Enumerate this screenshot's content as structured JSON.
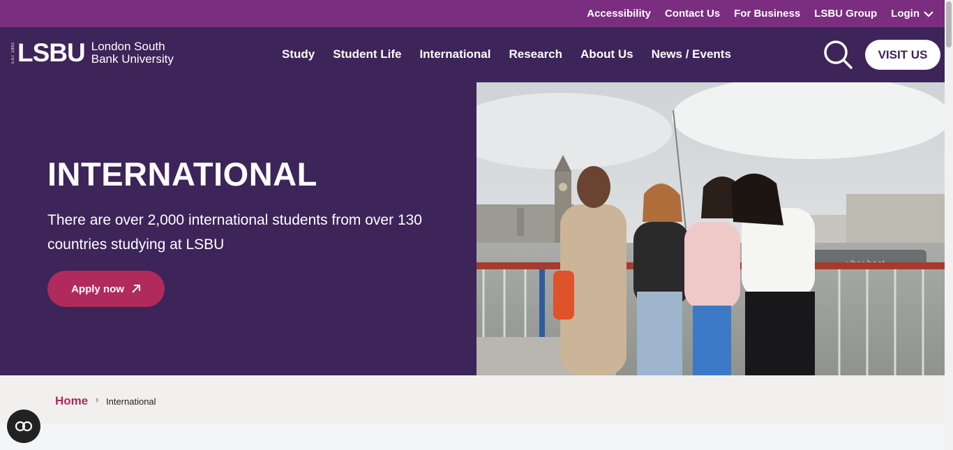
{
  "topbar": {
    "links": [
      "Accessibility",
      "Contact Us",
      "For Business",
      "LSBU Group"
    ],
    "login_label": "Login"
  },
  "logo": {
    "est": "EST 1892",
    "mark": "LSBU",
    "full_line1": "London South",
    "full_line2": "Bank University"
  },
  "nav": {
    "items": [
      "Study",
      "Student Life",
      "International",
      "Research",
      "About Us",
      "News / Events"
    ],
    "visit_label": "VISIT US"
  },
  "hero": {
    "title": "INTERNATIONAL",
    "text": "There are over 2,000 international students from over 130 countries studying at LSBU",
    "apply_label": "Apply now"
  },
  "photo": {
    "boat_text": "uber boat"
  },
  "breadcrumb": {
    "home": "Home",
    "separator": "›",
    "current": "International"
  },
  "colors": {
    "topbar": "#7b2d7f",
    "nav": "#3d2459",
    "accent": "#b02a5c"
  }
}
